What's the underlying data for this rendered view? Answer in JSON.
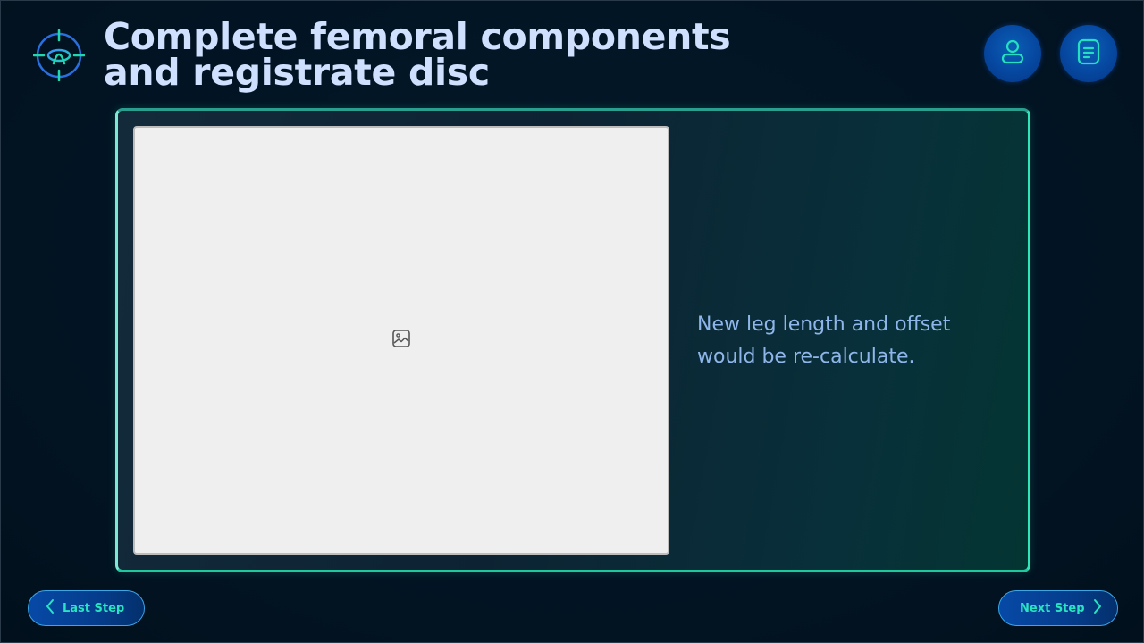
{
  "header": {
    "title_line1": "Complete femoral components",
    "title_line2": "and registrate disc",
    "logo_icon": "crosshair-logo-icon",
    "user_icon": "user-icon",
    "doc_icon": "document-icon"
  },
  "content": {
    "image_icon": "image-placeholder-icon",
    "description_line1": "New leg length and offset",
    "description_line2": "would be re-calculate."
  },
  "footer": {
    "prev_label": "Last Step",
    "prev_icon": "chevron-left-icon",
    "next_label": "Next Step",
    "next_icon": "chevron-right-icon"
  },
  "colors": {
    "background": "#021525",
    "title": "#cfe0ff",
    "accent_teal": "#29e3c2",
    "button_blue": "#0647a0",
    "description": "#8fb6ea"
  }
}
